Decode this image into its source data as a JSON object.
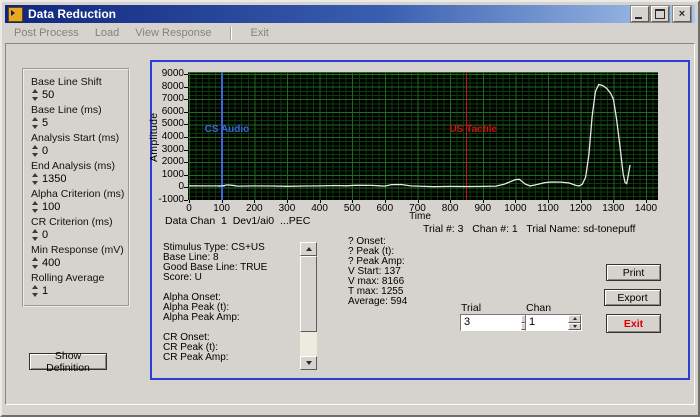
{
  "window": {
    "title": "Data Reduction",
    "close_glyph": "×"
  },
  "menu": {
    "items": [
      "Post Process",
      "Load",
      "View Response",
      "Exit"
    ]
  },
  "params_panel": {
    "fields": [
      {
        "label": "Base Line Shift",
        "value": "50"
      },
      {
        "label": "Base Line (ms)",
        "value": "5"
      },
      {
        "label": "Analysis Start (ms)",
        "value": "0"
      },
      {
        "label": "End Analysis (ms)",
        "value": "1350"
      },
      {
        "label": "Alpha Criterion (ms)",
        "value": "100"
      },
      {
        "label": "CR Criterion (ms)",
        "value": "0"
      },
      {
        "label": "Min Response (mV)",
        "value": "400"
      },
      {
        "label": "Rolling Average",
        "value": "1"
      }
    ]
  },
  "show_definition_label": "Show Definition",
  "chart_data": {
    "type": "line",
    "xlabel": "Time",
    "ylabel": "Amplitude",
    "xlim": [
      0,
      1437
    ],
    "ylim": [
      -1000,
      9000
    ],
    "x_ticks": [
      0,
      100,
      200,
      300,
      400,
      500,
      600,
      700,
      800,
      900,
      1000,
      1100,
      1200,
      1300,
      1400
    ],
    "y_ticks": [
      9000,
      8000,
      7000,
      6000,
      5000,
      4000,
      3000,
      2000,
      1000,
      0,
      -1000
    ],
    "grid": "on",
    "bg_color": "#000000",
    "grid_major_color": "#1e6b1e",
    "grid_minor_color": "#0d3a0d",
    "line_color": "#e8e8e8",
    "cursors": [
      {
        "label": "CS Audio",
        "x": 100,
        "color": "#3a64e0"
      },
      {
        "label": "US Tactile",
        "x": 850,
        "color": "#cc1212"
      }
    ],
    "series": [
      {
        "name": "response",
        "points": [
          [
            0,
            130
          ],
          [
            50,
            120
          ],
          [
            100,
            120
          ],
          [
            118,
            200
          ],
          [
            132,
            170
          ],
          [
            150,
            100
          ],
          [
            200,
            120
          ],
          [
            260,
            110
          ],
          [
            300,
            90
          ],
          [
            350,
            110
          ],
          [
            400,
            120
          ],
          [
            450,
            150
          ],
          [
            480,
            130
          ],
          [
            510,
            170
          ],
          [
            560,
            160
          ],
          [
            600,
            100
          ],
          [
            620,
            220
          ],
          [
            650,
            230
          ],
          [
            680,
            120
          ],
          [
            700,
            100
          ],
          [
            750,
            60
          ],
          [
            800,
            80
          ],
          [
            850,
            70
          ],
          [
            900,
            80
          ],
          [
            940,
            100
          ],
          [
            965,
            250
          ],
          [
            1000,
            620
          ],
          [
            1012,
            640
          ],
          [
            1030,
            260
          ],
          [
            1045,
            120
          ],
          [
            1065,
            220
          ],
          [
            1090,
            380
          ],
          [
            1110,
            430
          ],
          [
            1140,
            420
          ],
          [
            1165,
            350
          ],
          [
            1185,
            160
          ],
          [
            1195,
            120
          ],
          [
            1205,
            250
          ],
          [
            1215,
            800
          ],
          [
            1225,
            2600
          ],
          [
            1235,
            5600
          ],
          [
            1245,
            7600
          ],
          [
            1255,
            8166
          ],
          [
            1268,
            8080
          ],
          [
            1280,
            7850
          ],
          [
            1292,
            7450
          ],
          [
            1300,
            7000
          ],
          [
            1310,
            5400
          ],
          [
            1320,
            3300
          ],
          [
            1330,
            1100
          ],
          [
            1336,
            380
          ],
          [
            1341,
            300
          ],
          [
            1346,
            1000
          ],
          [
            1351,
            1780
          ]
        ]
      }
    ]
  },
  "chart_footer": {
    "data_chan_line": "Data Chan  1  Dev1/ai0  ...PEC",
    "trial_info": "Trial #: 3   Chan #: 1   Trial Name: sd-tonepuff"
  },
  "results": {
    "left": [
      "Stimulus Type: CS+US",
      "Base Line: 8",
      "Good Base Line: TRUE",
      "Score: U",
      "",
      "Alpha Onset:",
      "Alpha Peak (t):",
      "Alpha Peak Amp:",
      "",
      "CR Onset:",
      "CR Peak (t):",
      "CR Peak Amp:"
    ],
    "right": [
      "? Onset:",
      "? Peak (t):",
      "? Peak Amp:",
      "V Start: 137",
      "V max: 8166",
      "T max: 1255",
      "Average: 594"
    ]
  },
  "controls": {
    "trial": {
      "label": "Trial",
      "value": "3"
    },
    "chan": {
      "label": "Chan",
      "value": "1"
    },
    "buttons": {
      "print": "Print",
      "export": "Export",
      "exit": "Exit"
    },
    "exit_color": "#e00000"
  }
}
